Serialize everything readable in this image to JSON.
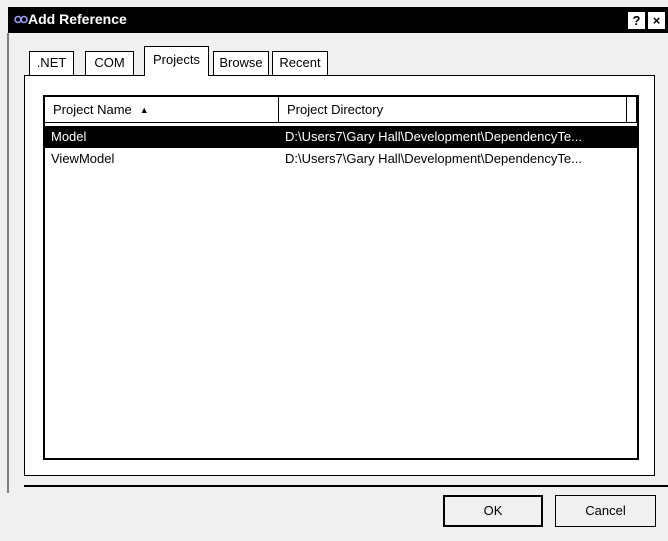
{
  "window": {
    "title": "Add Reference",
    "help_label": "?",
    "close_label": "×"
  },
  "tabs": [
    {
      "label": ".NET",
      "active": false
    },
    {
      "label": "COM",
      "active": false
    },
    {
      "label": "Projects",
      "active": true
    },
    {
      "label": "Browse",
      "active": false
    },
    {
      "label": "Recent",
      "active": false
    }
  ],
  "list": {
    "columns": [
      {
        "label": "Project Name",
        "sort": "ascending",
        "sort_glyph": "▲"
      },
      {
        "label": "Project Directory"
      }
    ],
    "rows": [
      {
        "name": "Model",
        "directory": "D:\\Users7\\Gary Hall\\Development\\DependencyTe...",
        "selected": true
      },
      {
        "name": "ViewModel",
        "directory": "D:\\Users7\\Gary Hall\\Development\\DependencyTe...",
        "selected": false
      }
    ]
  },
  "buttons": {
    "ok_label": "OK",
    "cancel_label": "Cancel"
  },
  "colors": {
    "titlebar": "#000000",
    "selection": "#000000",
    "window_bg": "#f0f0f0"
  }
}
